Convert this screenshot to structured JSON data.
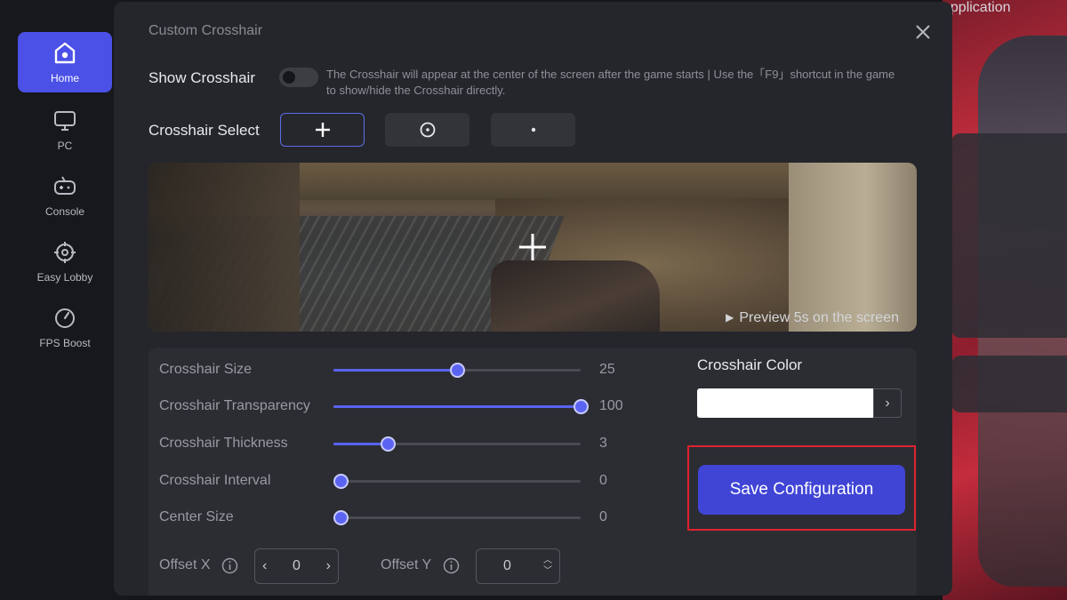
{
  "sidebar": {
    "items": [
      {
        "label": "Home",
        "icon": "home-icon",
        "active": true
      },
      {
        "label": "PC",
        "icon": "monitor-icon"
      },
      {
        "label": "Console",
        "icon": "gamepad-icon"
      },
      {
        "label": "Easy Lobby",
        "icon": "target-icon"
      },
      {
        "label": "FPS Boost",
        "icon": "gauge-icon"
      }
    ]
  },
  "background": {
    "text": "application"
  },
  "dialog": {
    "title": "Custom Crosshair",
    "show_crosshair": {
      "label": "Show Crosshair",
      "enabled": false,
      "hint": "The Crosshair will appear at the center of the screen after the game starts | Use the「F9」shortcut in the game to show/hide the Crosshair directly."
    },
    "crosshair_select": {
      "label": "Crosshair Select",
      "options": [
        "plus-icon",
        "circle-dot-icon",
        "dot-icon"
      ],
      "selected": 0
    },
    "preview": {
      "link_text": "Preview 5s on the screen"
    },
    "sliders": [
      {
        "label": "Crosshair Size",
        "value": 25,
        "fraction": 0.5
      },
      {
        "label": "Crosshair Transparency",
        "value": 100,
        "fraction": 1.0
      },
      {
        "label": "Crosshair Thickness",
        "value": 3,
        "fraction": 0.22
      },
      {
        "label": "Crosshair Interval",
        "value": 0,
        "fraction": 0.03
      },
      {
        "label": "Center Size",
        "value": 0,
        "fraction": 0.03
      }
    ],
    "offset_x": {
      "label": "Offset X",
      "value": "0"
    },
    "offset_y": {
      "label": "Offset Y",
      "value": "0"
    },
    "color": {
      "label": "Crosshair Color",
      "value": "#ffffff"
    },
    "save_label": "Save Configuration"
  },
  "colors": {
    "accent": "#4b50e6",
    "highlight_border": "#e0212e"
  }
}
